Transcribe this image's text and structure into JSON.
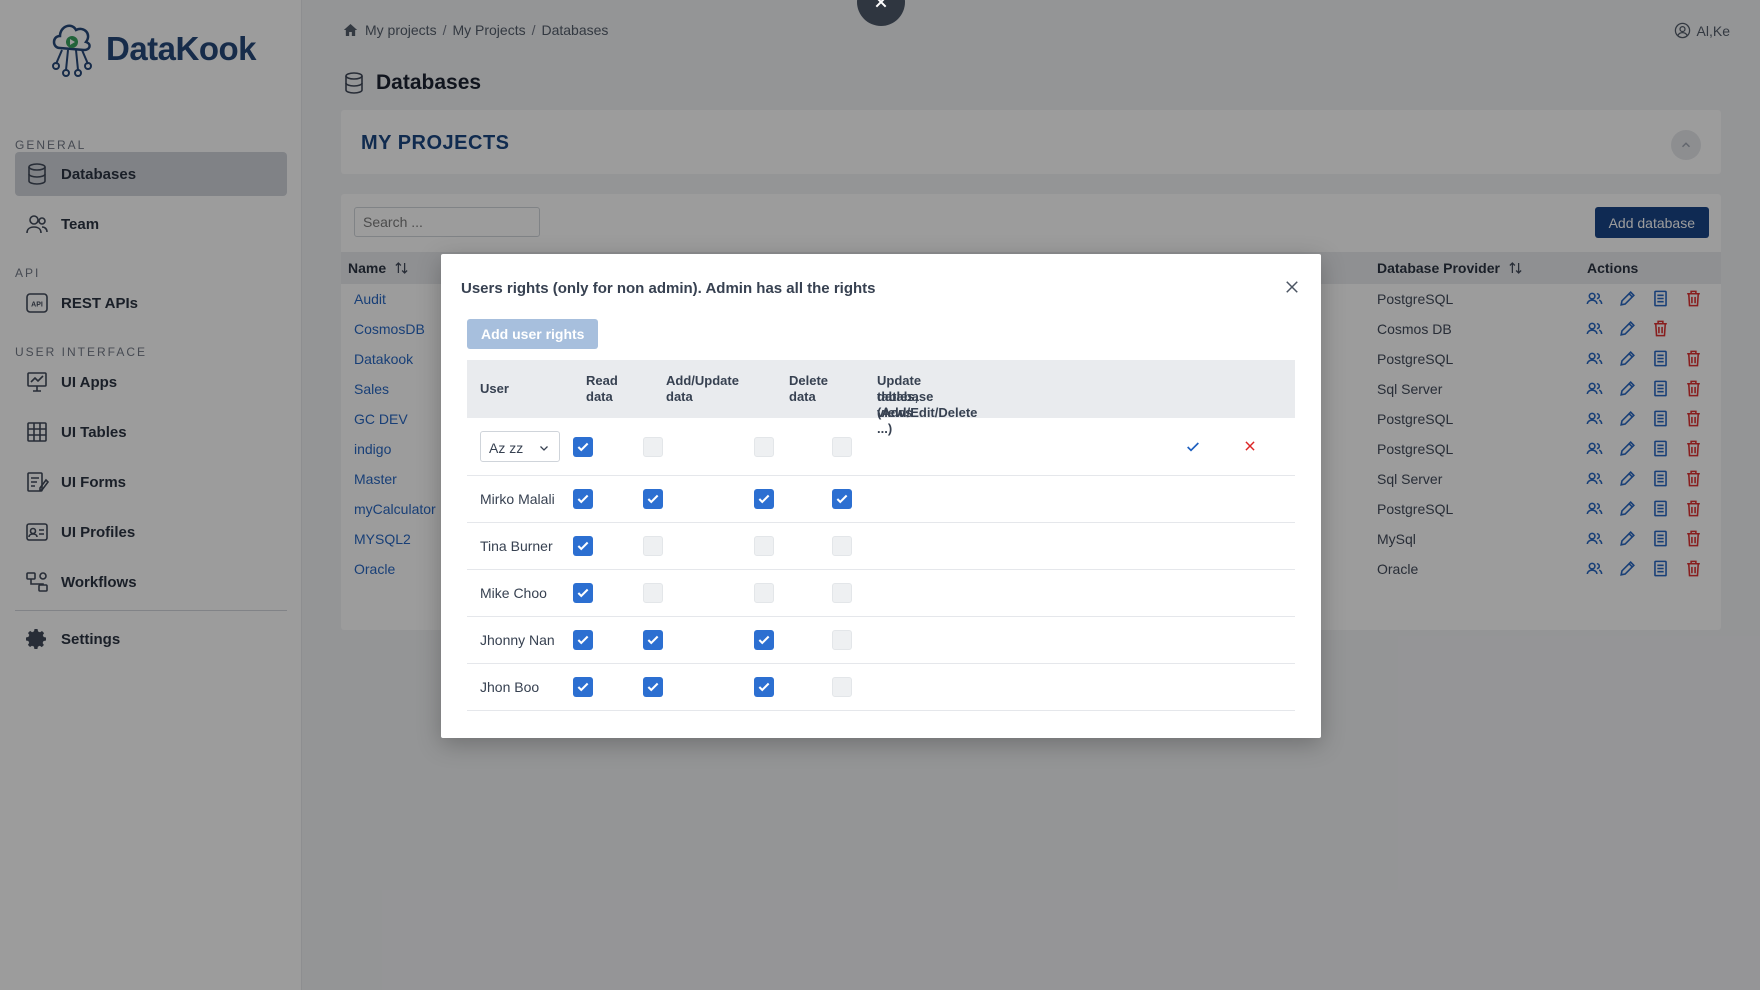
{
  "app": {
    "logo_text": "DataKook"
  },
  "sidebar": {
    "sections": {
      "general": "GENERAL",
      "api": "API",
      "ui": "USER INTERFACE"
    },
    "items": {
      "databases": "Databases",
      "team": "Team",
      "rest_apis": "REST APIs",
      "ui_apps": "UI Apps",
      "ui_tables": "UI Tables",
      "ui_forms": "UI Forms",
      "ui_profiles": "UI Profiles",
      "workflows": "Workflows",
      "settings": "Settings"
    }
  },
  "header": {
    "breadcrumb": [
      "My projects",
      "My Projects",
      "Databases"
    ],
    "user": "Al,Ke",
    "page_title": "Databases"
  },
  "projects_card": {
    "title": "MY PROJECTS"
  },
  "db_table": {
    "search_placeholder": "Search ...",
    "add_button": "Add database",
    "columns": {
      "name": "Name",
      "provider": "Database Provider",
      "actions": "Actions"
    },
    "rows": [
      {
        "name": "Audit",
        "provider": "PostgreSQL",
        "doc": true
      },
      {
        "name": "CosmosDB",
        "provider": "Cosmos DB",
        "doc": false
      },
      {
        "name": "Datakook",
        "provider": "PostgreSQL",
        "doc": true
      },
      {
        "name": "Sales",
        "provider": "Sql Server",
        "doc": true
      },
      {
        "name": "GC DEV",
        "provider": "PostgreSQL",
        "doc": true
      },
      {
        "name": "indigo",
        "provider": "PostgreSQL",
        "doc": true
      },
      {
        "name": "Master",
        "provider": "Sql Server",
        "doc": true
      },
      {
        "name": "myCalculator",
        "provider": "PostgreSQL",
        "doc": true
      },
      {
        "name": "MYSQL2",
        "provider": "MySql",
        "doc": true
      },
      {
        "name": "Oracle",
        "provider": "Oracle",
        "doc": true
      }
    ]
  },
  "modal": {
    "title": "Users rights (only for non admin). Admin has all the rights",
    "add_button": "Add user rights",
    "columns": {
      "user": "User",
      "read_1": "Read",
      "read_2": "data",
      "add_1": "Add/Update",
      "add_2": "data",
      "delete_1": "Delete",
      "delete_2": "data",
      "update_1": "Update database (Add/Edit/Delete",
      "update_2": "tables, views ...)"
    },
    "edit_row": {
      "selected_user": "Az zz",
      "read": true,
      "add": false,
      "delete": false,
      "update": false
    },
    "rows": [
      {
        "user": "Mirko Malali",
        "read": true,
        "add": true,
        "delete": true,
        "update": true
      },
      {
        "user": "Tina Burner",
        "read": true,
        "add": false,
        "delete": false,
        "update": false
      },
      {
        "user": "Mike Choo",
        "read": true,
        "add": false,
        "delete": false,
        "update": false
      },
      {
        "user": "Jhonny Nan",
        "read": true,
        "add": true,
        "delete": true,
        "update": false
      },
      {
        "user": "Jhon Boo",
        "read": true,
        "add": true,
        "delete": true,
        "update": false
      }
    ]
  },
  "colors": {
    "primary": "#0d3b82",
    "link": "#1d5fbf",
    "danger": "#dc2626",
    "checkbox": "#2c6fd1"
  }
}
